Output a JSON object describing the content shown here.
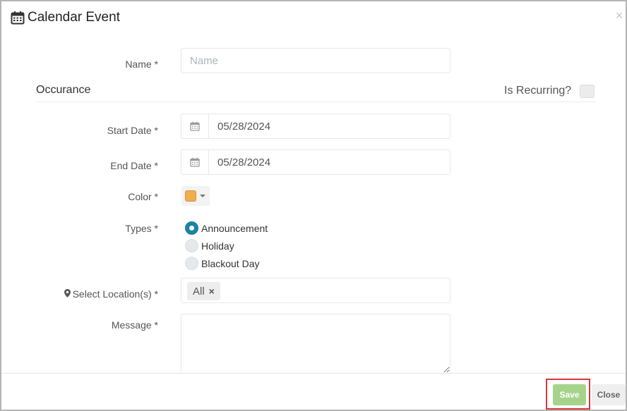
{
  "modal": {
    "title": "Calendar Event",
    "close_symbol": "×",
    "title_icon": "calendar-icon"
  },
  "form": {
    "name": {
      "label": "Name *",
      "placeholder": "Name",
      "value": ""
    },
    "occurrence": {
      "section_title": "Occurance",
      "recurring_label": "Is Recurring?",
      "recurring_checked": false
    },
    "start_date": {
      "label": "Start Date *",
      "value": "05/28/2024",
      "icon": "calendar-icon"
    },
    "end_date": {
      "label": "End Date *",
      "value": "05/28/2024",
      "icon": "calendar-icon"
    },
    "color": {
      "label": "Color *",
      "value": "#f0ad4e"
    },
    "types": {
      "label": "Types *",
      "options": [
        {
          "label": "Announcement",
          "checked": true
        },
        {
          "label": "Holiday",
          "checked": false
        },
        {
          "label": "Blackout Day",
          "checked": false
        }
      ]
    },
    "locations": {
      "label": "Select Location(s) *",
      "icon": "map-marker-icon",
      "tags": [
        {
          "label": "All",
          "remove_symbol": "×"
        }
      ]
    },
    "message": {
      "label": "Message *",
      "value": ""
    }
  },
  "footer": {
    "save_label": "Save",
    "close_label": "Close"
  },
  "colors": {
    "accent_radio": "#1a83a6",
    "save_button": "#a6d38c",
    "highlight_border": "#d9383a"
  }
}
